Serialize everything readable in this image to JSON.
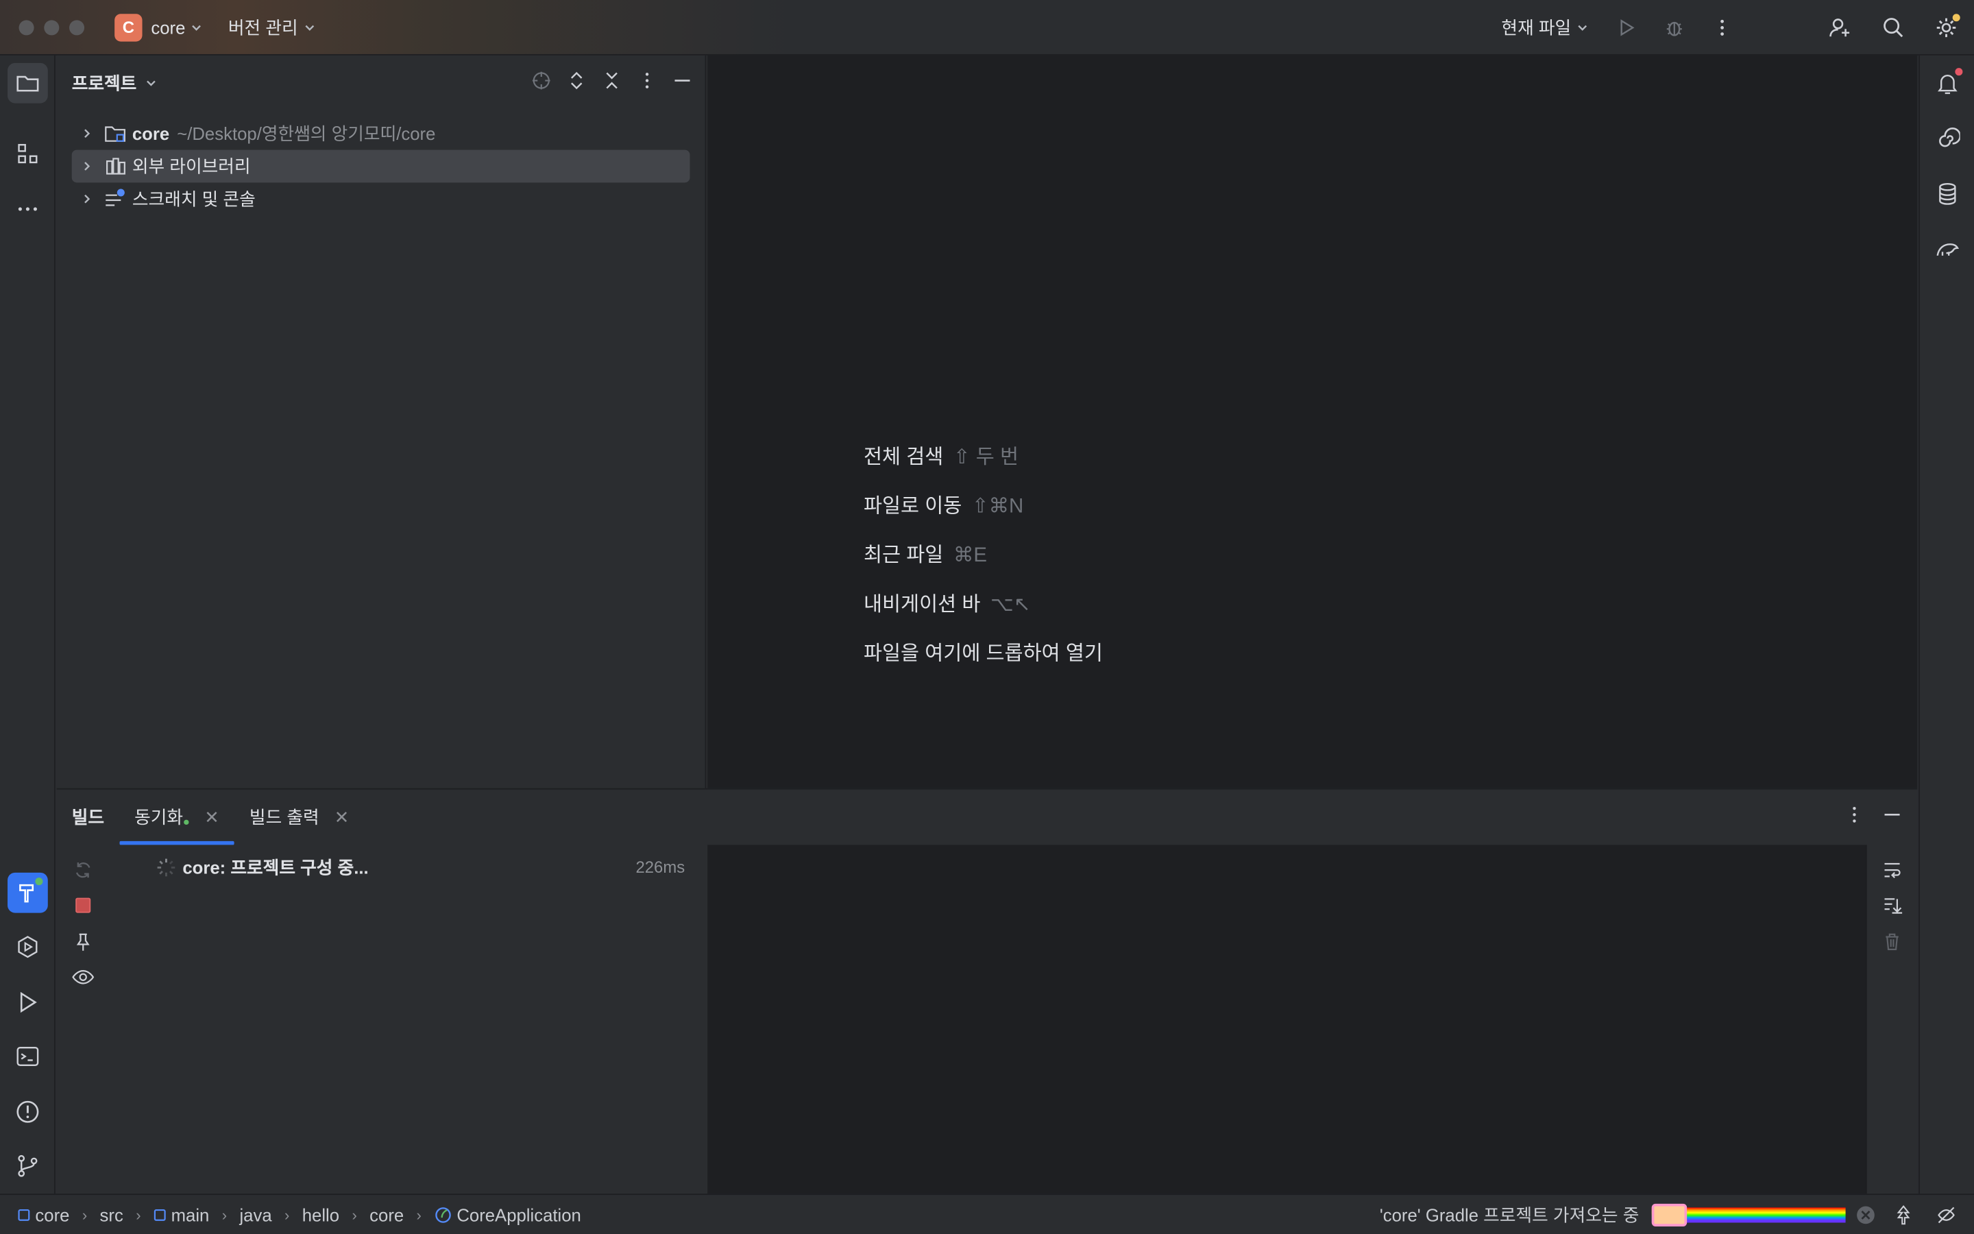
{
  "titlebar": {
    "project_initial": "C",
    "project_name": "core",
    "vcs_menu": "버전 관리",
    "run_config": "현재 파일"
  },
  "project_panel": {
    "title": "프로젝트",
    "tree": [
      {
        "label": "core",
        "path": "~/Desktop/영한쌤의 앙기모띠/core"
      },
      {
        "label": "외부 라이브러리"
      },
      {
        "label": "스크래치 및 콘솔"
      }
    ]
  },
  "editor_hints": [
    {
      "label": "전체 검색",
      "key": "⇧ 두 번"
    },
    {
      "label": "파일로 이동",
      "key": "⇧⌘N"
    },
    {
      "label": "최근 파일",
      "key": "⌘E"
    },
    {
      "label": "내비게이션 바",
      "key": "⌥↖"
    },
    {
      "label": "파일을 여기에 드롭하여 열기",
      "key": ""
    }
  ],
  "build_panel": {
    "title": "빌드",
    "tabs": [
      "동기화",
      "빌드 출력"
    ],
    "task_label": "core: 프로젝트 구성 중...",
    "task_time": "226ms"
  },
  "status_bar": {
    "breadcrumb": [
      "core",
      "src",
      "main",
      "java",
      "hello",
      "core",
      "CoreApplication"
    ],
    "task_text": "'core' Gradle 프로젝트 가져오는 중"
  },
  "colors": {
    "accent": "#3574f0",
    "project_badge": "#e3765a",
    "background": "#2b2d30",
    "editor_bg": "#1e1f22"
  }
}
